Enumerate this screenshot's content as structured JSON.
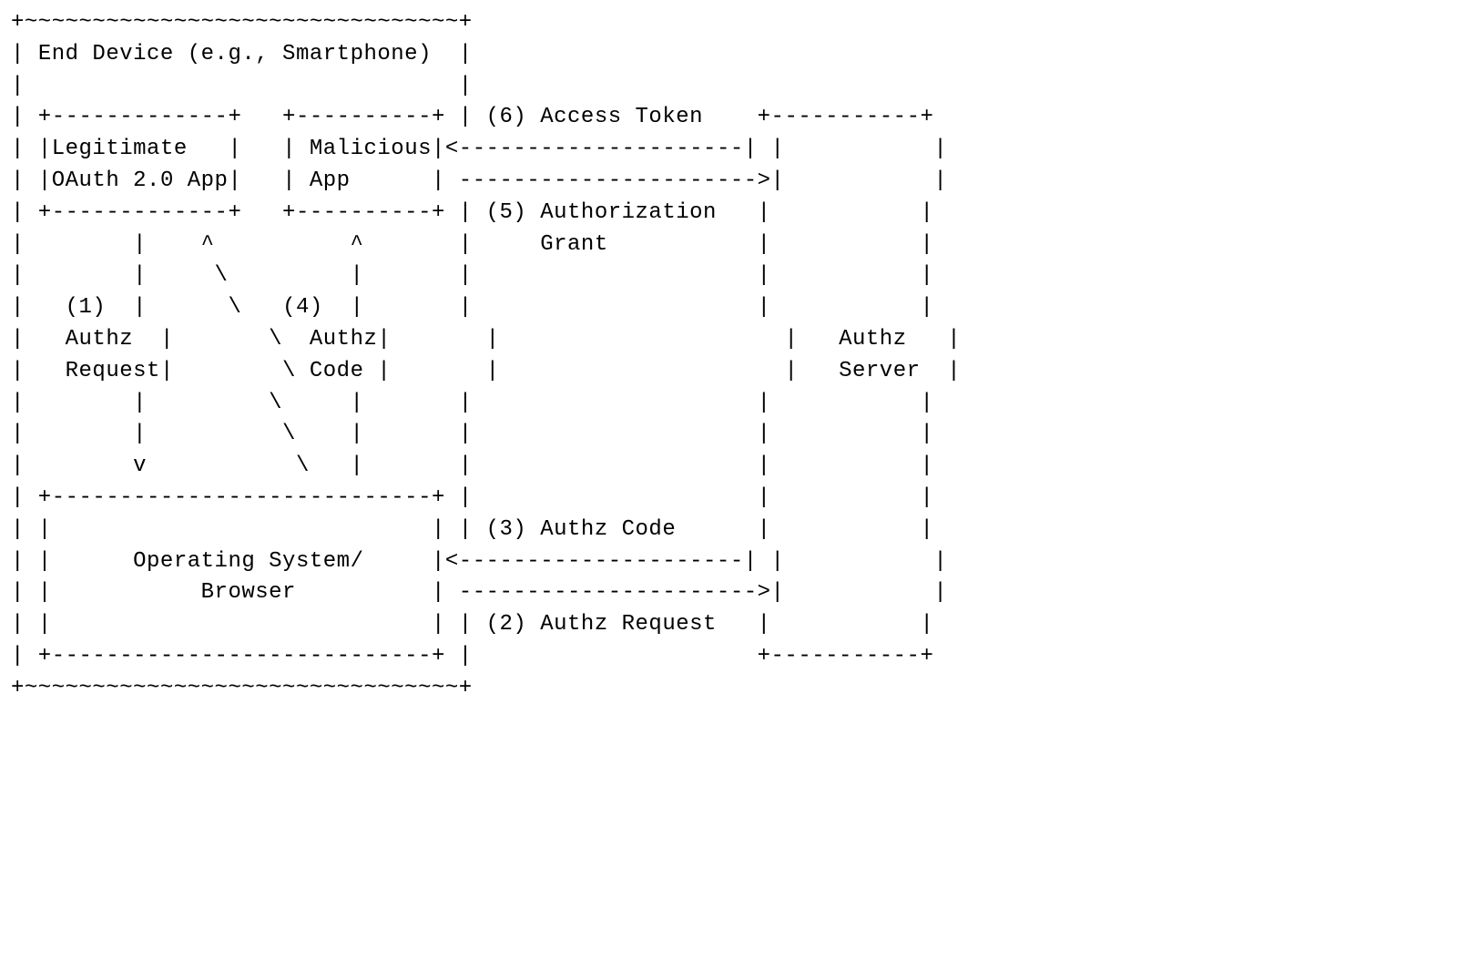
{
  "entities": {
    "device_title": "End Device (e.g., Smartphone)",
    "legit_app_line1": "Legitimate   ",
    "legit_app_line2": "OAuth 2.0 App",
    "malicious_app": "Malicious",
    "malicious_app_line2": "App      ",
    "os_browser_line1": "Operating System/",
    "os_browser_line2": "     Browser     ",
    "authz_server_line1": "Authz ",
    "authz_server_line2": "Server"
  },
  "steps": {
    "s1_num": "(1)  ",
    "s1_l1": "Authz  ",
    "s1_l2": "Request",
    "s4_num": "(4)  ",
    "s4_l1": "Authz",
    "s4_l2": "Code ",
    "s2": "(2) Authz Request  ",
    "s3": "(3) Authz Code     ",
    "s5_l1": "(5) Authorization  ",
    "s5_l2": "    Grant          ",
    "s6": "(6) Access Token   "
  },
  "lines": {
    "l01": "+~~~~~~~~~~~~~~~~~~~~~~~~~~~~~~~~+",
    "l02": "|                                |",
    "l03": "| +-------------+   +----------+ |                     +-----------+",
    "l04": "| |             |   |         |<---------------------| |           |",
    "l05": "| |             |   |         | ---------------------->|           |",
    "l06": "| +-------------+   +----------+ |                     |           |",
    "l07": "|        |    ^          ^       |                     |           |",
    "l08": "|        |     \\         |       |                     |           |",
    "l09": "|        |      \\        |       |                     |           |",
    "l10": "|        |       \\       |       |                     |           |",
    "l11": "|        |        \\      |       |                     |           |",
    "l12": "|        |         \\     |       |                     |           |",
    "l13": "|        v          \\    |       |                     |           |",
    "l14": "| +----------------------------+ |                     |           |",
    "l15": "| |                            | |                     |           |",
    "l16": "| |                            |<---------------------| |           |",
    "l17": "| |                            | ---------------------->|           |",
    "l18": "| |                            | |                     |           |",
    "l19": "| +----------------------------+ |                     +-----------+",
    "l20": "+~~~~~~~~~~~~~~~~~~~~~~~~~~~~~~~~+"
  }
}
